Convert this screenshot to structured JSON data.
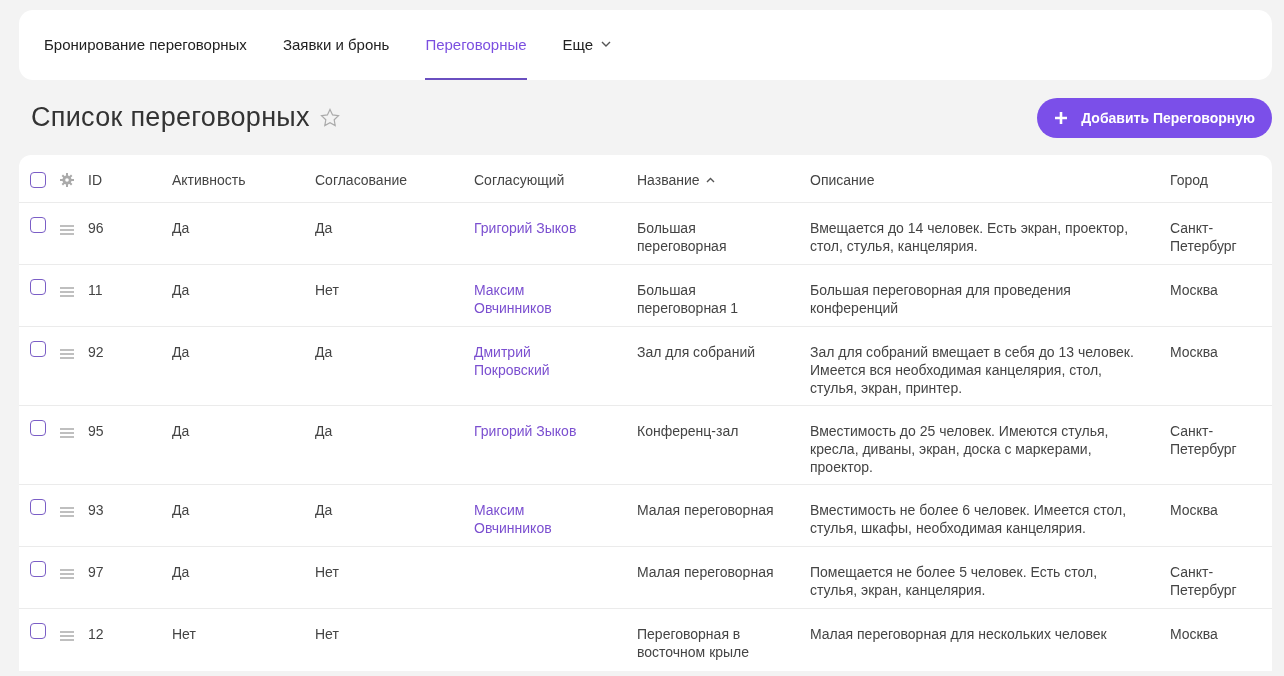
{
  "tabs": [
    {
      "label": "Бронирование переговорных",
      "selected": false,
      "kind": "tab"
    },
    {
      "label": "Заявки и бронь",
      "selected": false,
      "kind": "tab"
    },
    {
      "label": "Переговорные",
      "selected": true,
      "kind": "tab"
    },
    {
      "label": "Еще",
      "selected": false,
      "kind": "dropdown"
    }
  ],
  "page": {
    "title": "Список переговорных",
    "favorite": false,
    "add_button": "Добавить Переговорную"
  },
  "table": {
    "select_all": {
      "checked": false
    },
    "columns": [
      {
        "label": "ID"
      },
      {
        "label": "Активность"
      },
      {
        "label": "Согласование"
      },
      {
        "label": "Согласующий"
      },
      {
        "label": "Название",
        "sorted": true
      },
      {
        "label": "Описание"
      },
      {
        "label": "Город"
      }
    ],
    "rows": [
      {
        "checked": false,
        "id": "96",
        "active": "Да",
        "approval": "Да",
        "approver": "Григорий Зыков",
        "name": "Большая переговорная",
        "description": "Вмещается до 14 человек. Есть экран, проектор, стол, стулья, канцелярия.",
        "city": "Санкт-Петербург"
      },
      {
        "checked": false,
        "id": "11",
        "active": "Да",
        "approval": "Нет",
        "approver": "Максим Овчинников",
        "name": "Большая переговорная 1",
        "description": "Большая переговорная для проведения конференций",
        "city": "Москва"
      },
      {
        "checked": false,
        "id": "92",
        "active": "Да",
        "approval": "Да",
        "approver": "Дмитрий Покровский",
        "name": "Зал для собраний",
        "description": "Зал для собраний вмещает в себя до 13 человек. Имеется вся необходимая канцелярия, стол, стулья, экран, принтер.",
        "city": "Москва"
      },
      {
        "checked": false,
        "id": "95",
        "active": "Да",
        "approval": "Да",
        "approver": "Григорий Зыков",
        "name": "Конференц-зал",
        "description": "Вместимость до 25 человек. Имеются стулья, кресла, диваны, экран, доска с маркерами, проектор.",
        "city": "Санкт-Петербург"
      },
      {
        "checked": false,
        "id": "93",
        "active": "Да",
        "approval": "Да",
        "approver": "Максим Овчинников",
        "name": "Малая переговорная",
        "description": "Вместимость не более 6 человек. Имеется стол, стулья, шкафы, необходимая канцелярия.",
        "city": "Москва"
      },
      {
        "checked": false,
        "id": "97",
        "active": "Да",
        "approval": "Нет",
        "name": "Малая переговорная",
        "description": "Помещается не более 5 человек. Есть стол, стулья, экран, канцелярия.",
        "city": "Санкт-Петербург"
      },
      {
        "checked": false,
        "id": "12",
        "active": "Нет",
        "approval": "Нет",
        "name": "Переговорная в восточном крыле",
        "description": "Малая переговорная для нескольких человек",
        "city": "Москва"
      }
    ]
  }
}
